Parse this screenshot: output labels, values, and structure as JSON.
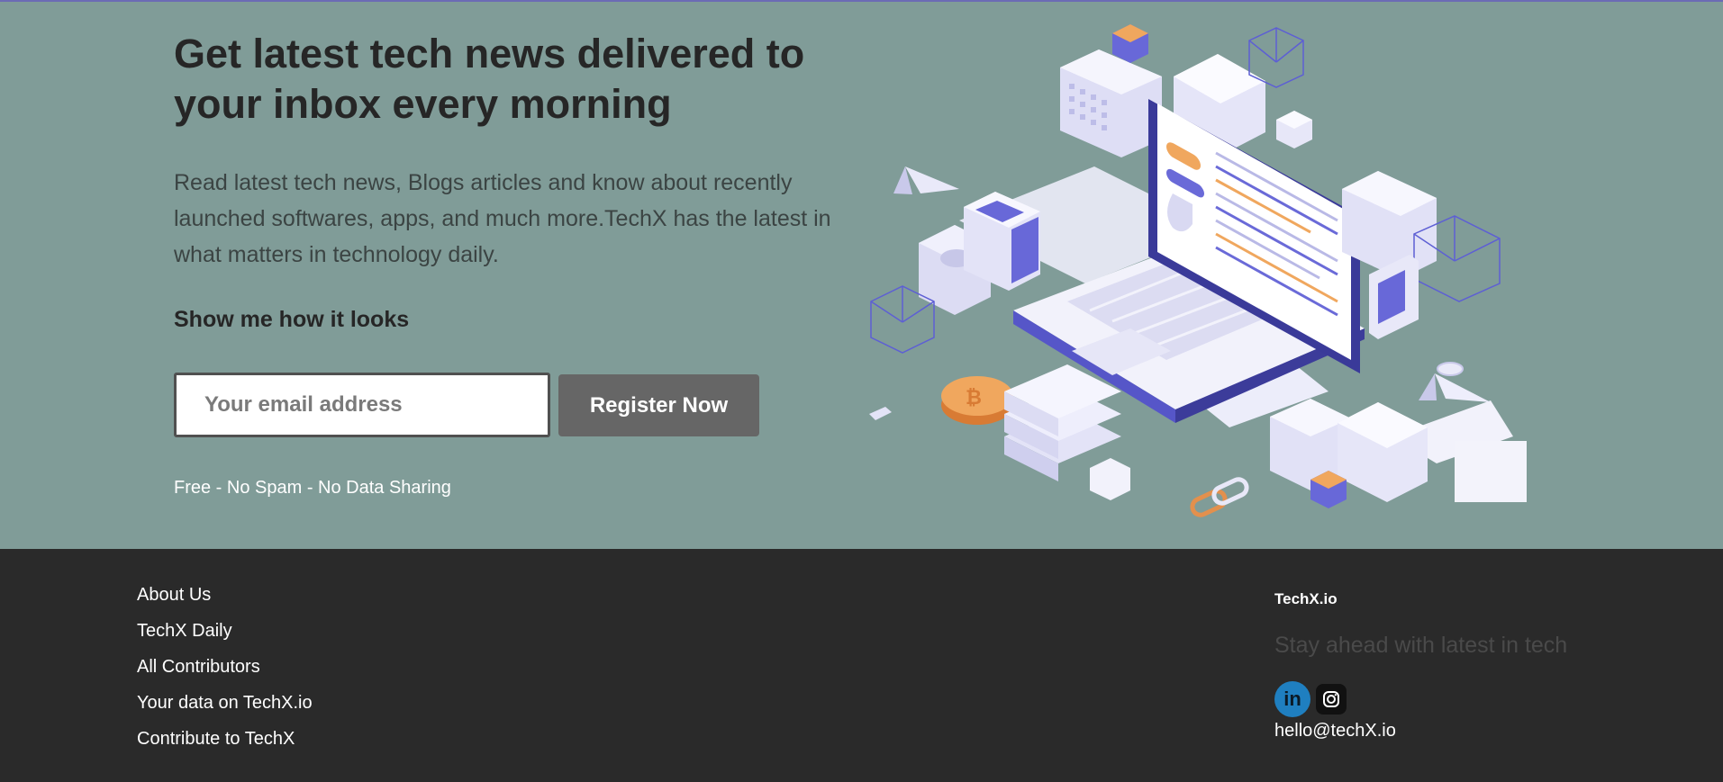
{
  "hero": {
    "title": "Get latest tech news delivered to your inbox every morning",
    "description": "Read latest tech news, Blogs articles and know about recently launched softwares, apps, and much more.TechX has the latest in what matters in technology daily.",
    "preview_link": "Show me how it looks",
    "email_placeholder": "Your email address",
    "register_label": "Register Now",
    "fine_print": "Free - No Spam - No Data Sharing",
    "illustration": "isometric-laptop-tech-illustration"
  },
  "footer": {
    "links": [
      {
        "label": "About Us"
      },
      {
        "label": "TechX Daily"
      },
      {
        "label": "All Contributors"
      },
      {
        "label": "Your data on TechX.io"
      },
      {
        "label": "Contribute to TechX"
      }
    ],
    "brand": "TechX.io",
    "tagline": "Stay ahead with latest in tech",
    "social": [
      {
        "name": "linkedin-icon",
        "glyph": "in",
        "color": "#1f7fc0"
      },
      {
        "name": "instagram-icon",
        "color": "#111111"
      }
    ],
    "email": "hello@techX.io"
  },
  "colors": {
    "hero_bg": "#809c98",
    "footer_bg": "#2a2a2a",
    "button_bg": "#666666",
    "accent": "#6b6bb5"
  }
}
